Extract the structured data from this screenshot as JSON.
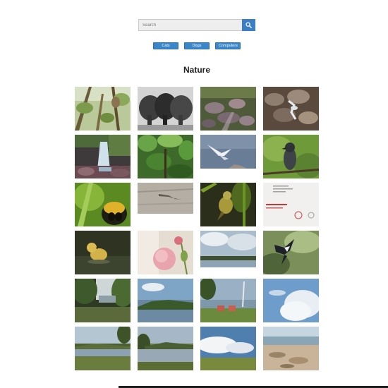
{
  "search": {
    "placeholder": "Search",
    "value": ""
  },
  "filters": [
    {
      "label": "Cats"
    },
    {
      "label": "Dogs"
    },
    {
      "label": "Computers"
    }
  ],
  "gallery": {
    "title": "Nature",
    "photos": [
      {
        "subject": "owl in tree branches"
      },
      {
        "subject": "elephants black and white"
      },
      {
        "subject": "rocky forest stream"
      },
      {
        "subject": "stream over rocks"
      },
      {
        "subject": "waterfall in forest"
      },
      {
        "subject": "green forest canopy"
      },
      {
        "subject": "gull in flight"
      },
      {
        "subject": "bird perched on branch"
      },
      {
        "subject": "bee close-up"
      },
      {
        "subject": "lizard on driftwood"
      },
      {
        "subject": "warbler on plant"
      },
      {
        "subject": "handwritten letter page"
      },
      {
        "subject": "duckling in water"
      },
      {
        "subject": "pink roses"
      },
      {
        "subject": "lake with clouds"
      },
      {
        "subject": "magpie in flight"
      },
      {
        "subject": "trees by lake"
      },
      {
        "subject": "lake and hills"
      },
      {
        "subject": "lake shore with chairs"
      },
      {
        "subject": "blue sky with clouds"
      },
      {
        "subject": "lake view with trees"
      },
      {
        "subject": "lake with hills and trees"
      },
      {
        "subject": "clouds over field"
      },
      {
        "subject": "rocky beach shore"
      }
    ]
  }
}
